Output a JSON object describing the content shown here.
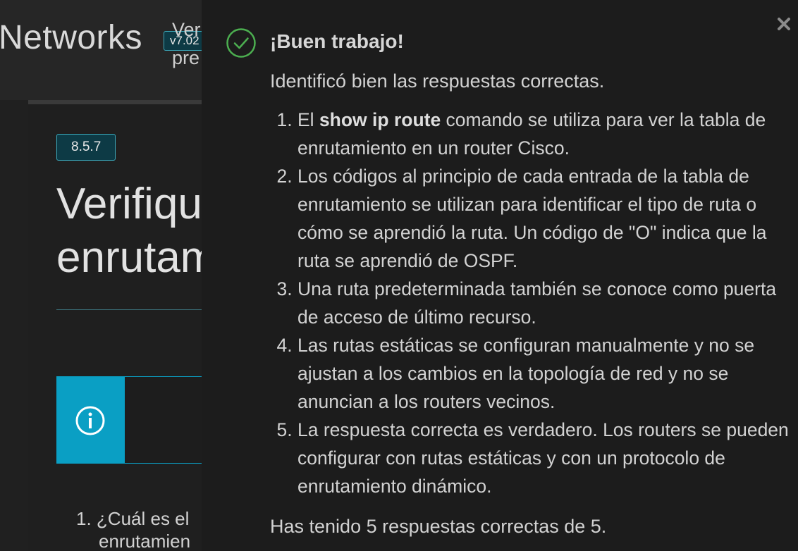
{
  "background": {
    "course_title": "Networks",
    "version": "v7.02",
    "section_number": "8.5.7",
    "heading_line1": "Verifique",
    "heading_line2": "enrutamiento",
    "info_line1": "Ver",
    "info_line2": "pre",
    "question_line1": "1. ¿Cuál es el",
    "question_line2": "enrutamien"
  },
  "feedback": {
    "title": "¡Buen trabajo!",
    "intro": "Identificó bien las respuestas correctas.",
    "items": [
      {
        "pre": "El ",
        "bold": "show ip route",
        "post": " comando se utiliza para ver la tabla de enrutamiento en un router Cisco."
      },
      {
        "text": "Los códigos al principio de cada entrada de la tabla de enrutamiento se utilizan para identificar el tipo de ruta o cómo se aprendió la ruta. Un código de \"O\" indica que la ruta se aprendió de OSPF."
      },
      {
        "text": "Una ruta predeterminada también se conoce como puerta de acceso de último recurso."
      },
      {
        "text": "Las rutas estáticas se configuran manualmente y no se ajustan a los cambios en la topología de red y no se anuncian a los routers vecinos."
      },
      {
        "text": "La respuesta correcta es verdadero. Los routers se pueden configurar con rutas estáticas y con un protocolo de enrutamiento dinámico."
      }
    ],
    "score": "Has tenido 5 respuestas correctas de 5."
  },
  "icons": {
    "close": "close-icon",
    "check": "check-circle-icon",
    "info": "info-icon"
  },
  "colors": {
    "accent": "#0a9fc4",
    "success": "#4caf50",
    "badge_bg": "#0d3a45"
  }
}
